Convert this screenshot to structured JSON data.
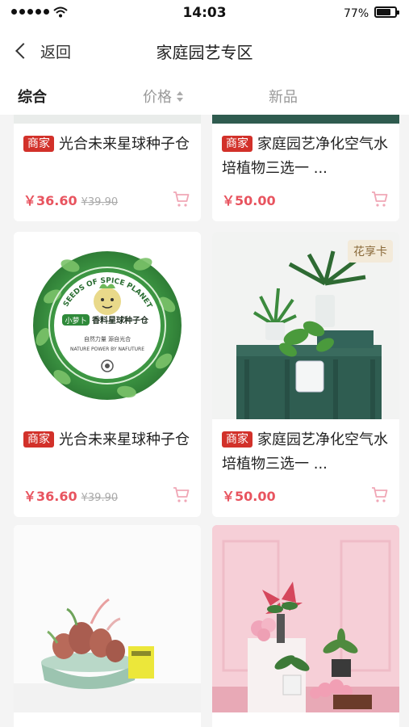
{
  "status_bar": {
    "time": "14:03",
    "battery": "77%"
  },
  "nav": {
    "back_label": "返回",
    "title": "家庭园艺专区"
  },
  "filters": {
    "tab1": "综合",
    "tab2": "价格",
    "tab3": "新品"
  },
  "products": [
    {
      "badge": "商家",
      "title": "光合未来星球种子仓",
      "price": "￥36.60",
      "old_price": "¥39.90"
    },
    {
      "badge": "商家",
      "title": "家庭园艺净化空气水培植物三选一 ...",
      "price": "￥50.00"
    },
    {
      "badge": "商家",
      "title": "光合未来星球种子仓",
      "price": "￥36.60",
      "old_price": "¥39.90",
      "image": {
        "ring_text": "SEEDS OF SPICE PLANET",
        "tag": "小萝卜",
        "name": "香料星球种子仓",
        "line1": "自然力量 源自光合",
        "line2": "NATURE POWER BY NAFUTURE"
      }
    },
    {
      "badge": "商家",
      "title": "家庭园艺净化空气水培植物三选一 ...",
      "price": "￥50.00",
      "ribbon": "花享卡"
    },
    {
      "image": "potted-bulb-plant"
    },
    {
      "image": "pink-room-plants"
    }
  ],
  "colors": {
    "badge": "#d2312a",
    "price": "#e8545f",
    "accent_pink": "#f0bcc6"
  }
}
